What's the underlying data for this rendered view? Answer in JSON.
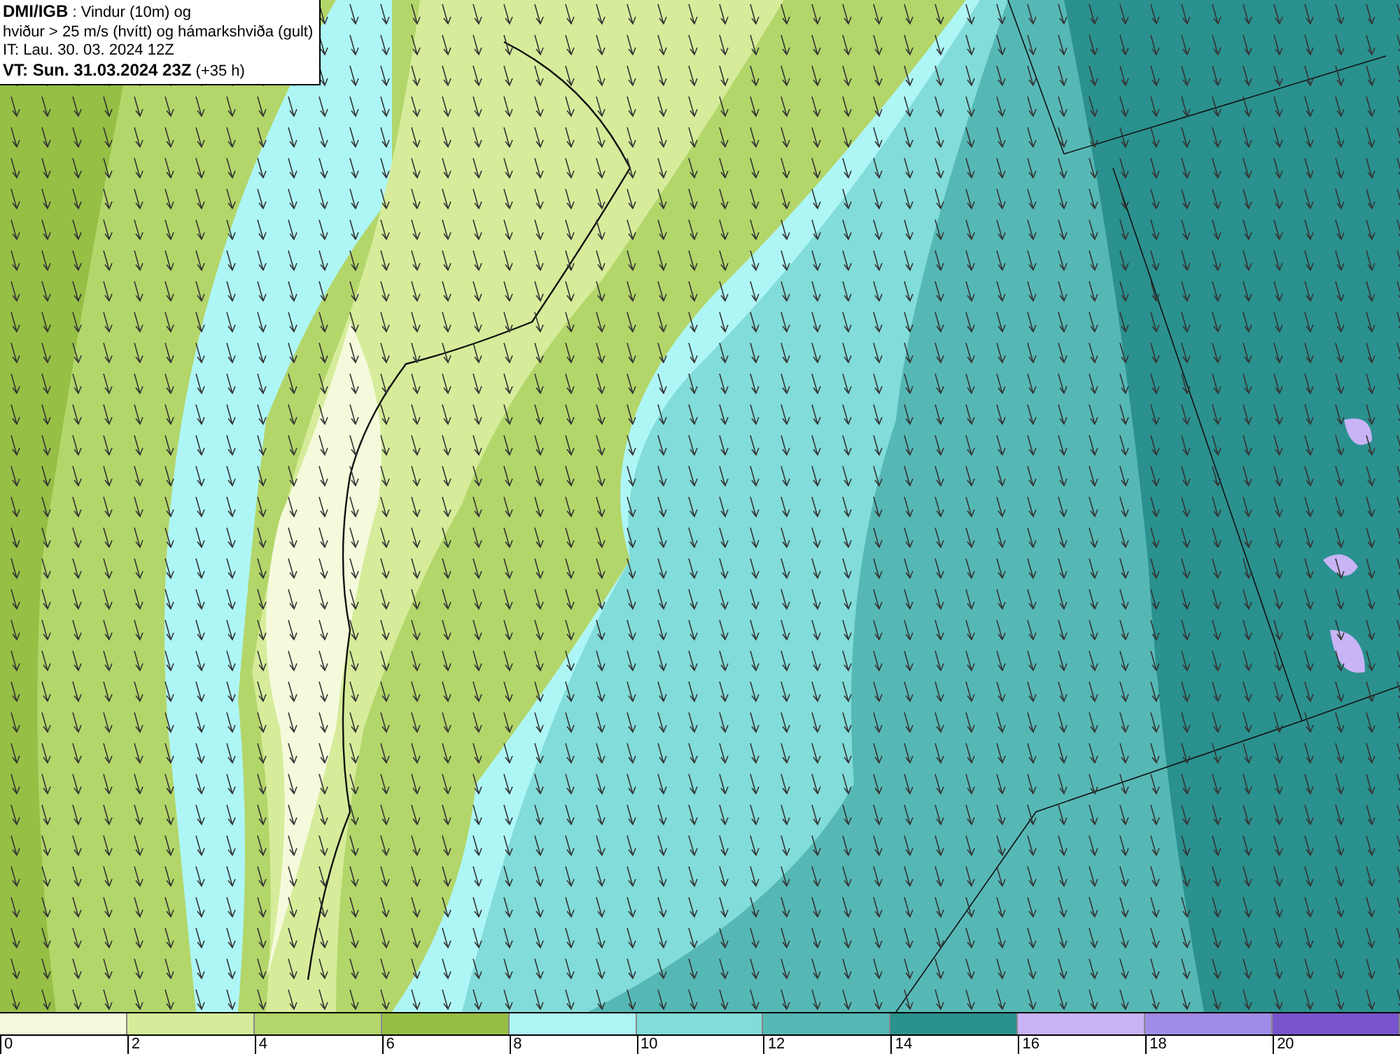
{
  "legend": {
    "lines": [
      "**DMI/IGB** : Vindur (10m) og",
      "hviður > 25 m/s (hvítt) og hámarkshviða (gult)",
      "IT: Lau. 30. 03. 2024 12Z",
      "**VT: Sun. 31.03.2024 23Z** (+35 h)"
    ]
  },
  "colorbar": {
    "bins": [
      {
        "label": "0",
        "color": "#f5fadc"
      },
      {
        "label": "2",
        "color": "#d6ec9a"
      },
      {
        "label": "4",
        "color": "#b3d66a"
      },
      {
        "label": "6",
        "color": "#96bf45"
      },
      {
        "label": "8",
        "color": "#aef6f6"
      },
      {
        "label": "10",
        "color": "#82dcd9"
      },
      {
        "label": "12",
        "color": "#56b8b5"
      },
      {
        "label": "14",
        "color": "#2a918e"
      },
      {
        "label": "16",
        "color": "#c8b4f6"
      },
      {
        "label": "18",
        "color": "#a08ce6"
      },
      {
        "label": "20",
        "color": "#7855cc"
      }
    ]
  }
}
